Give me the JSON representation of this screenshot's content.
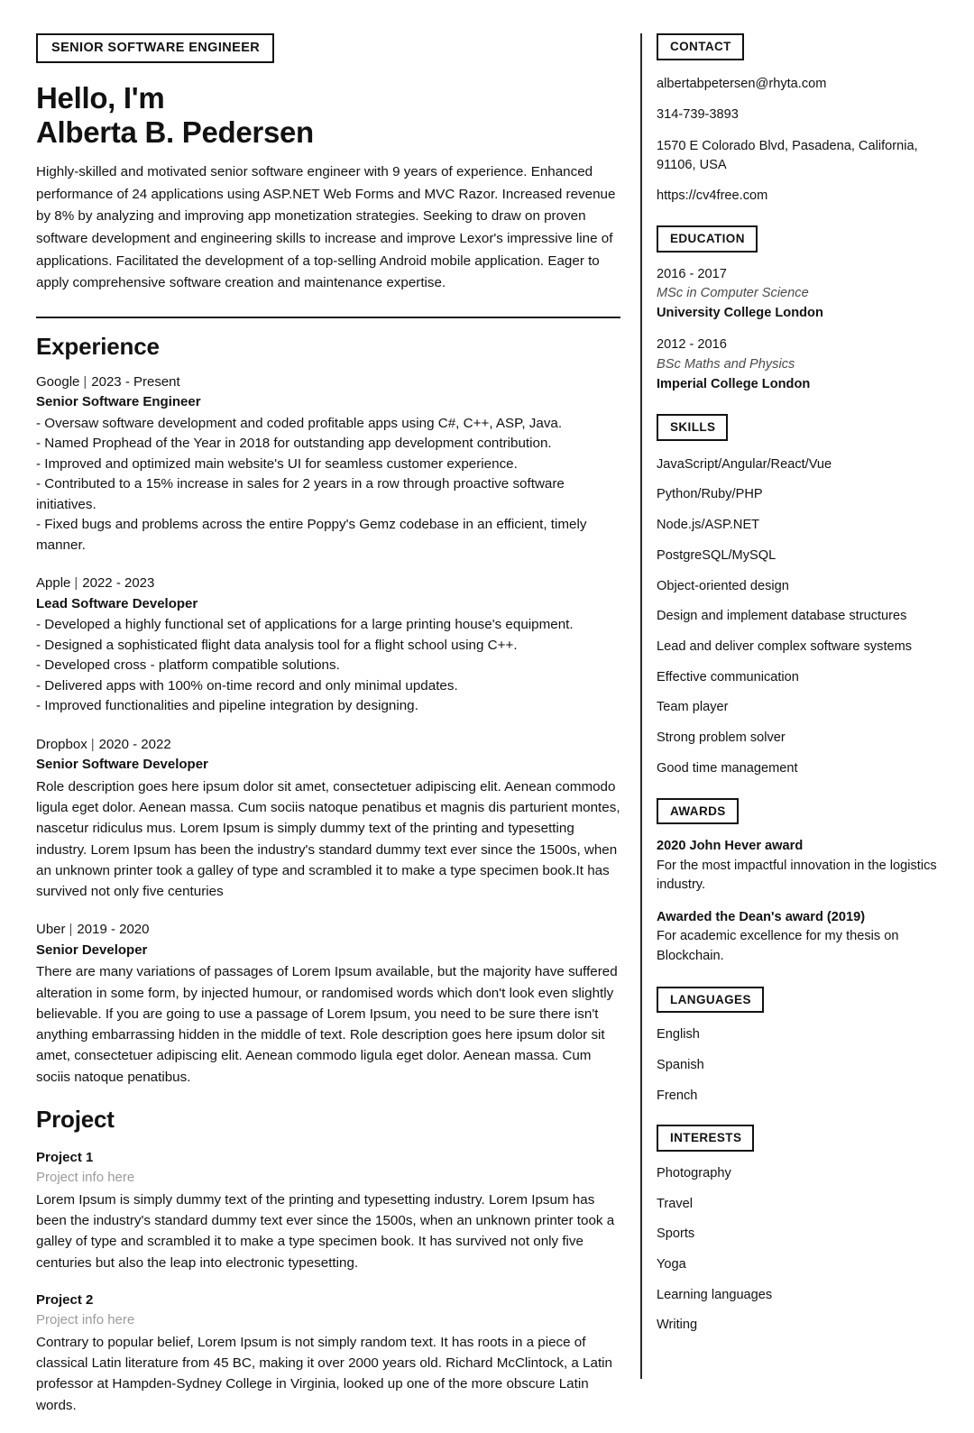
{
  "header": {
    "job_title_badge": "SENIOR SOFTWARE ENGINEER",
    "greeting": "Hello, I'm",
    "full_name": "Alberta B. Pedersen",
    "summary": "Highly-skilled and motivated senior software engineer with 9 years of experience. Enhanced performance of 24 applications using ASP.NET Web Forms and MVC Razor. Increased revenue by 8% by analyzing and improving app monetization strategies. Seeking to draw on proven software development and engineering skills to increase and improve Lexor's impressive line of applications. Facilitated the development of a top-selling Android mobile application. Eager to apply comprehensive software creation and maintenance expertise."
  },
  "experience": {
    "title": "Experience",
    "separator": "|",
    "jobs": [
      {
        "company": "Google",
        "dates": "2023 - Present",
        "role": "Senior Software Engineer",
        "bullets": [
          "- Oversaw software development and coded profitable apps using C#, C++, ASP, Java.",
          "- Named Prophead of the Year in 2018 for outstanding app development contribution.",
          "- Improved and optimized main website's UI for seamless customer experience.",
          "- Contributed to a 15% increase in sales for 2 years in a row through proactive software initiatives.",
          "- Fixed bugs and problems across the entire Poppy's Gemz codebase in an efficient, timely manner."
        ],
        "description": ""
      },
      {
        "company": "Apple",
        "dates": "2022 - 2023",
        "role": "Lead Software Developer",
        "bullets": [
          "- Developed a highly functional set of applications for a large printing house's equipment.",
          "- Designed a sophisticated flight data analysis tool for a flight school using C++.",
          "- Developed cross - platform compatible solutions.",
          "- Delivered apps with 100% on-time record and only minimal updates.",
          "- Improved functionalities and pipeline integration by designing."
        ],
        "description": ""
      },
      {
        "company": "Dropbox",
        "dates": "2020 - 2022",
        "role": "Senior Software Developer",
        "bullets": [],
        "description": "Role description goes here ipsum dolor sit amet, consectetuer adipiscing elit. Aenean commodo ligula eget dolor. Aenean massa. Cum sociis natoque penatibus et magnis dis parturient montes, nascetur ridiculus mus. Lorem Ipsum is simply dummy text of the printing and typesetting industry. Lorem Ipsum has been the industry's standard dummy text ever since the 1500s, when an unknown printer took a galley of type and scrambled it to make a type specimen book.It has survived not only five centuries"
      },
      {
        "company": "Uber",
        "dates": "2019 - 2020",
        "role": "Senior Developer",
        "bullets": [],
        "description": "There are many variations of passages of Lorem Ipsum available, but the majority have suffered alteration in some form, by injected humour, or randomised words which don't look even slightly believable. If you are going to use a passage of Lorem Ipsum, you need to be sure there isn't anything embarrassing hidden in the middle of text. Role description goes here ipsum dolor sit amet, consectetuer adipiscing elit. Aenean commodo ligula eget dolor. Aenean massa. Cum sociis natoque penatibus."
      }
    ]
  },
  "project": {
    "title": "Project",
    "items": [
      {
        "name": "Project 1",
        "info": "Project info here",
        "description": "Lorem Ipsum is simply dummy text of the printing and typesetting industry. Lorem Ipsum has been the industry's standard dummy text ever since the 1500s, when an unknown printer took a galley of type and scrambled it to make a type specimen book. It has survived not only five centuries but also the leap into electronic typesetting."
      },
      {
        "name": "Project 2",
        "info": "Project info here",
        "description": "Contrary to popular belief, Lorem Ipsum is not simply random text. It has roots in a piece of classical Latin literature from 45 BC, making it over 2000 years old. Richard McClintock, a Latin professor at Hampden-Sydney College in Virginia, looked up one of the more obscure Latin words."
      }
    ]
  },
  "contact": {
    "heading": "CONTACT",
    "email": "albertabpetersen@rhyta.com",
    "phone": "314-739-3893",
    "address": "1570 E Colorado Blvd, Pasadena, California, 91106, USA",
    "website": "https://cv4free.com"
  },
  "education": {
    "heading": "EDUCATION",
    "entries": [
      {
        "years": "2016 - 2017",
        "degree": "MSc in Computer Science",
        "school": "University College London"
      },
      {
        "years": "2012 - 2016",
        "degree": "BSc Maths and Physics",
        "school": "Imperial College London"
      }
    ]
  },
  "skills": {
    "heading": "SKILLS",
    "items": [
      "JavaScript/Angular/React/Vue",
      "Python/Ruby/PHP",
      "Node.js/ASP.NET",
      "PostgreSQL/MySQL",
      "Object-oriented design",
      "Design and implement database structures",
      "Lead and deliver complex software systems",
      "Effective communication",
      "Team player",
      "Strong problem solver",
      "Good time management"
    ]
  },
  "awards": {
    "heading": "AWARDS",
    "entries": [
      {
        "name": "2020 John Hever award",
        "description": "For the most impactful innovation in the logistics industry."
      },
      {
        "name": "Awarded the Dean's award (2019)",
        "description": "For academic excellence for my thesis on Blockchain."
      }
    ]
  },
  "languages": {
    "heading": "LANGUAGES",
    "items": [
      "English",
      "Spanish",
      "French"
    ]
  },
  "interests": {
    "heading": "INTERESTS",
    "items": [
      "Photography",
      "Travel",
      "Sports",
      "Yoga",
      "Learning languages",
      "Writing"
    ]
  }
}
